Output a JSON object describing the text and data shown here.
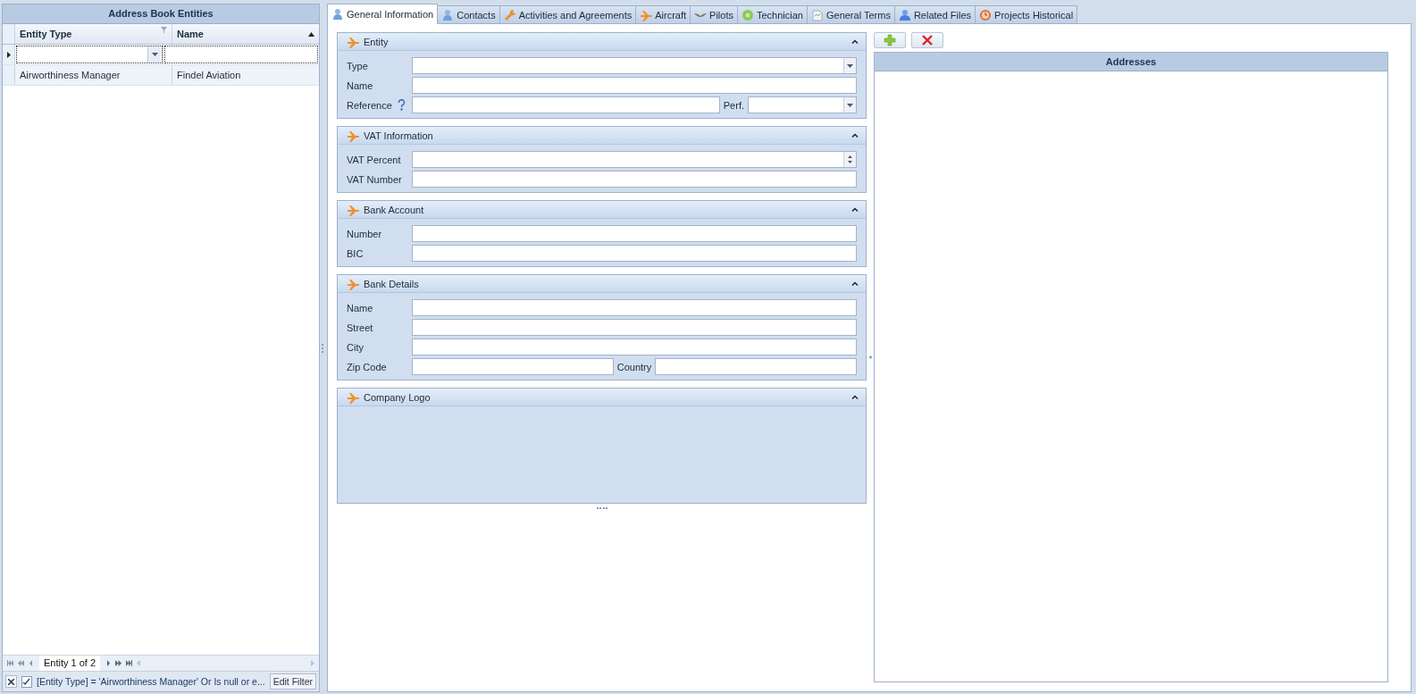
{
  "entities_panel": {
    "title": "Address Book Entities",
    "columns": [
      {
        "label": "Entity Type",
        "filter": true,
        "sorted": false
      },
      {
        "label": "Name",
        "filter": false,
        "sorted": true
      }
    ],
    "filter_row": {
      "selected": true
    },
    "rows": [
      {
        "cells": [
          "Airworthiness Manager",
          "Findel Aviation"
        ],
        "selected": false
      }
    ],
    "navigator": {
      "text": "Entity 1 of 2"
    },
    "filter_bar": {
      "checked": true,
      "text": "[Entity Type] = 'Airworthiness Manager' Or Is null or e...",
      "button": "Edit Filter"
    }
  },
  "tabs": [
    {
      "label": "General Information",
      "selected": true
    },
    {
      "label": "Contacts",
      "selected": false
    },
    {
      "label": "Activities and Agreements",
      "selected": false
    },
    {
      "label": "Aircraft",
      "selected": false
    },
    {
      "label": "Pilots",
      "selected": false
    },
    {
      "label": "Technician",
      "selected": false
    },
    {
      "label": "General Terms",
      "selected": false
    },
    {
      "label": "Related Files",
      "selected": false
    },
    {
      "label": "Projects Historical",
      "selected": false
    }
  ],
  "groups": [
    {
      "title": "Entity",
      "kind": "form",
      "expanded": true,
      "rows": [
        [
          {
            "label": "Type",
            "kind": "combo"
          }
        ],
        [
          {
            "label": "Name",
            "kind": "text"
          }
        ],
        [
          {
            "label": "Reference",
            "kind": "text",
            "help": true
          },
          {
            "label": "Perf.",
            "kind": "combo"
          }
        ]
      ]
    },
    {
      "title": "VAT Information",
      "kind": "form",
      "expanded": true,
      "rows": [
        [
          {
            "label": "VAT Percent",
            "kind": "spin"
          }
        ],
        [
          {
            "label": "VAT Number",
            "kind": "text"
          }
        ]
      ]
    },
    {
      "title": "Bank Account",
      "kind": "form",
      "expanded": true,
      "rows": [
        [
          {
            "label": "Number",
            "kind": "text"
          }
        ],
        [
          {
            "label": "BIC",
            "kind": "text"
          }
        ]
      ]
    },
    {
      "title": "Bank Details",
      "kind": "form",
      "expanded": true,
      "rows": [
        [
          {
            "label": "Name",
            "kind": "text"
          }
        ],
        [
          {
            "label": "Street",
            "kind": "text"
          }
        ],
        [
          {
            "label": "City",
            "kind": "text"
          }
        ],
        [
          {
            "label": "Zip Code",
            "kind": "text"
          },
          {
            "label": "Country",
            "kind": "text"
          }
        ]
      ]
    },
    {
      "title": "Company Logo",
      "kind": "image",
      "expanded": true
    }
  ],
  "addresses": {
    "title": "Addresses",
    "buttons": [
      {
        "kind": "add"
      },
      {
        "kind": "delete"
      }
    ]
  }
}
